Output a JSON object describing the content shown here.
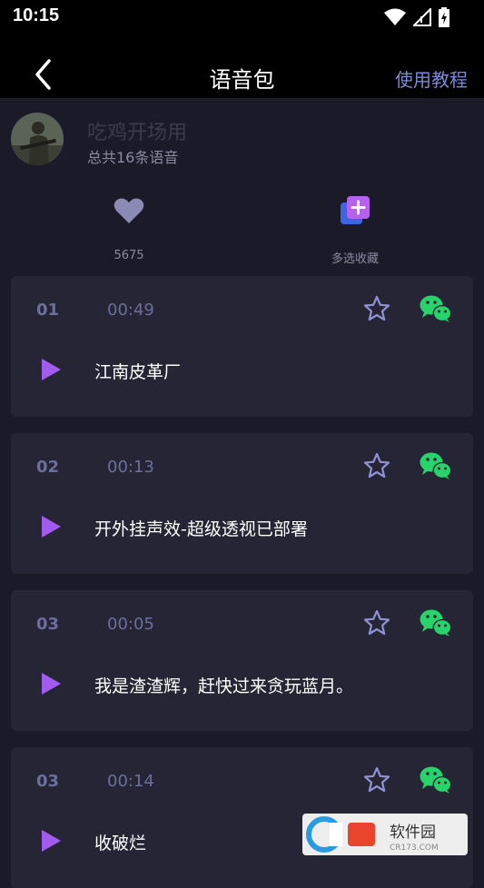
{
  "status_bar": {
    "time": "10:15"
  },
  "nav": {
    "title": "语音包",
    "tutorial_label": "使用教程"
  },
  "pack": {
    "name": "吃鸡开场用",
    "count_text": "总共16条语音"
  },
  "stats": {
    "likes": "5675",
    "multi_select_label": "多选收藏"
  },
  "items": [
    {
      "index": "01",
      "duration": "00:49",
      "title": "江南皮革厂"
    },
    {
      "index": "02",
      "duration": "00:13",
      "title": "开外挂声效-超级透视已部署"
    },
    {
      "index": "03",
      "duration": "00:05",
      "title": "我是渣渣辉，赶快过来贪玩蓝月。"
    },
    {
      "index": "03",
      "duration": "00:14",
      "title": "收破烂"
    }
  ],
  "watermark": {
    "text_main": "软件园",
    "text_sub": "CR173.COM"
  },
  "colors": {
    "background": "#1b1a29",
    "card": "#262535",
    "accent_purple": "#a35bef",
    "wechat_green": "#29d36b",
    "muted_text": "#6a6f9c",
    "link_blue": "#7c8ad8"
  }
}
